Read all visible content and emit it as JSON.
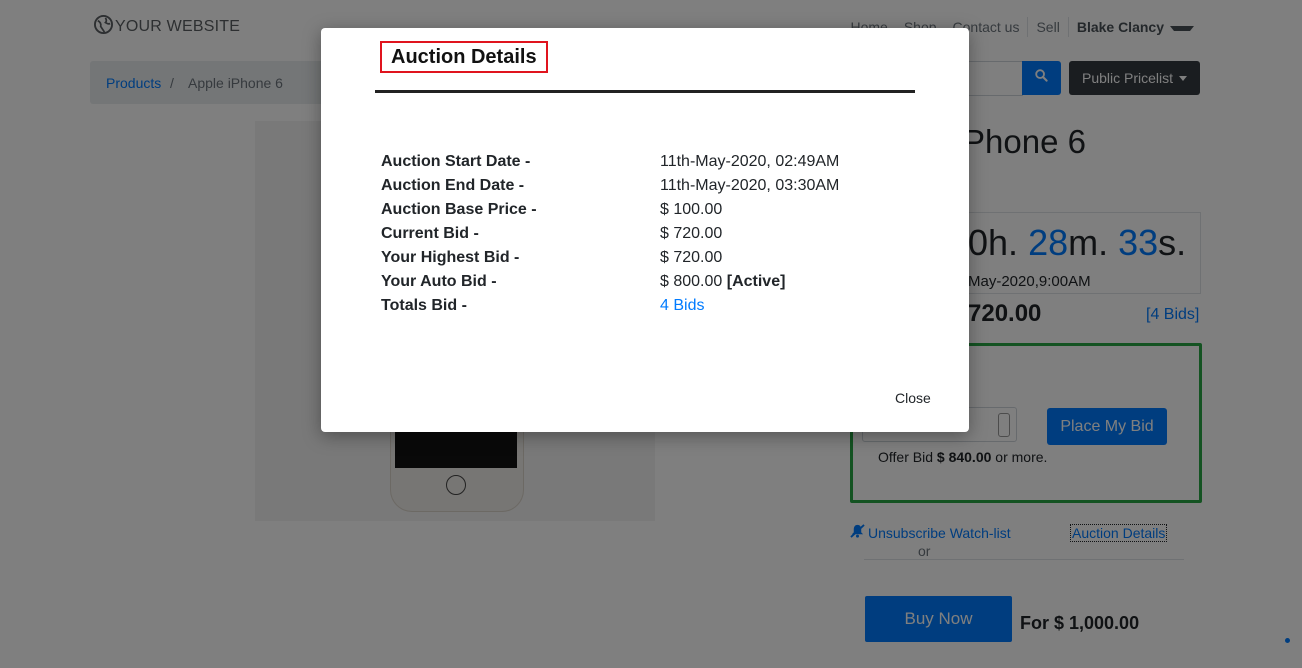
{
  "navbar": {
    "brand": "YOUR WEBSITE",
    "links": [
      "Home",
      "Shop",
      "Contact us",
      "Sell"
    ],
    "user": "Blake Clancy"
  },
  "breadcrumb": {
    "parent": "Products",
    "separator": "/",
    "current": "Apple iPhone 6"
  },
  "toolbar": {
    "pricelist": "Public Pricelist"
  },
  "product": {
    "title_visible": "Phone 6",
    "countdown": {
      "hours_suffix": "0h.",
      "minutes": "28",
      "minutes_suffix": "m.",
      "seconds": "33",
      "seconds_suffix": "s."
    },
    "end_date_visible": "May-2020,9:00AM",
    "current_price_visible": "720.00",
    "bids_link": "[4 Bids]",
    "place_bid_button": "Place My Bid",
    "offer": {
      "prefix": "Offer Bid",
      "amount": "$ 840.00",
      "suffix": "or more."
    },
    "unsubscribe": "Unsubscribe Watch-list",
    "or": "or",
    "auction_details_link": "Auction Details",
    "buy_now_button": "Buy Now",
    "buy_price": "For $ 1,000.00"
  },
  "modal": {
    "title": "Auction Details",
    "rows": [
      {
        "label": "Auction Start Date -",
        "value": "11th-May-2020, 02:49AM"
      },
      {
        "label": "Auction End Date -",
        "value": "11th-May-2020, 03:30AM"
      },
      {
        "label": "Auction Base Price -",
        "value": "$ 100.00"
      },
      {
        "label": "Current Bid -",
        "value": "$ 720.00"
      },
      {
        "label": "Your Highest Bid -",
        "value": "$ 720.00"
      },
      {
        "label": "Your Auto Bid -",
        "value": "$ 800.00",
        "status": "[Active]"
      },
      {
        "label": "Totals Bid -",
        "value": "4 Bids"
      }
    ],
    "close": "Close"
  },
  "colors": {
    "primary": "#007bff",
    "success": "#28a745",
    "dark": "#343a40",
    "highlight": "#e0141e"
  }
}
